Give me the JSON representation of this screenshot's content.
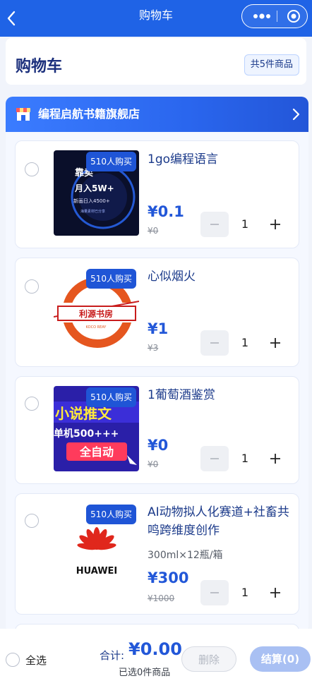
{
  "nav": {
    "title": "购物车"
  },
  "header": {
    "title": "购物车",
    "count_badge": "共5件商品"
  },
  "shop": {
    "name": "编程启航书籍旗舰店"
  },
  "items": [
    {
      "name": "1go编程语言",
      "spec": "",
      "price": "¥0.1",
      "old_price": "¥0",
      "quantity": "1",
      "badge": "510人购买",
      "thumb": {
        "lines": [
          "靠卖",
          "月入5W+",
          "新画日入4500+",
          "海量素材已分享"
        ]
      }
    },
    {
      "name": "心似烟火",
      "spec": "",
      "price": "¥1",
      "old_price": "¥3",
      "quantity": "1",
      "badge": "510人购买",
      "thumb": {
        "lines": [
          "利源书房",
          "KOCO REAY"
        ]
      }
    },
    {
      "name": "1葡萄酒鉴赏",
      "spec": "",
      "price": "¥0",
      "old_price": "¥0",
      "quantity": "1",
      "badge": "510人购买",
      "thumb": {
        "lines": [
          "小说推文",
          "单机500+++",
          "全自动"
        ]
      }
    },
    {
      "name": "AI动物拟人化赛道+社畜共鸣跨维度创作",
      "spec": "300ml×12瓶/箱",
      "price": "¥300",
      "old_price": "¥1000",
      "quantity": "1",
      "badge": "510人购买",
      "thumb": {
        "lines": [
          "HUAWEI"
        ]
      }
    }
  ],
  "bottom": {
    "select_all": "全选",
    "total_label": "合计:",
    "total_value": "¥0.00",
    "selected_count": "已选0件商品",
    "delete_label": "删除",
    "checkout_label": "结算(0)"
  },
  "colors": {
    "brand": "#1f63e6",
    "price": "#2257d8",
    "title": "#1b2f7c"
  },
  "icons": [
    "back-arrow-icon",
    "more-dots-icon",
    "capsule-close-icon",
    "shop-icon",
    "chevron-right-icon",
    "minus-icon",
    "plus-icon"
  ]
}
